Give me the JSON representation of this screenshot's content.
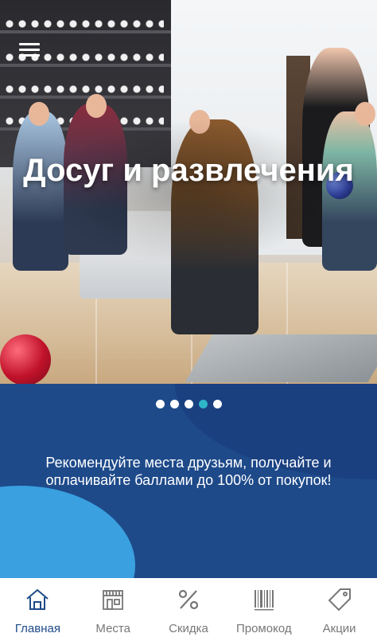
{
  "hero": {
    "title": "Досуг и развлечения"
  },
  "slider": {
    "dot_count": 5,
    "active_index": 3
  },
  "promo": {
    "text": "Рекомендуйте места друзьям, получайте и оплачивайте баллами до 100% от покупок!"
  },
  "bottom_nav": {
    "items": [
      {
        "label": "Главная",
        "icon": "home-icon"
      },
      {
        "label": "Места",
        "icon": "store-icon"
      },
      {
        "label": "Скидка",
        "icon": "percent-icon"
      },
      {
        "label": "Промокод",
        "icon": "barcode-icon"
      },
      {
        "label": "Акции",
        "icon": "tag-icon"
      }
    ],
    "active_index": 0
  },
  "colors": {
    "primary": "#1e4a8a",
    "accent": "#2fb6c9",
    "light_blue": "#3aa0e0",
    "nav_inactive": "#777777"
  }
}
